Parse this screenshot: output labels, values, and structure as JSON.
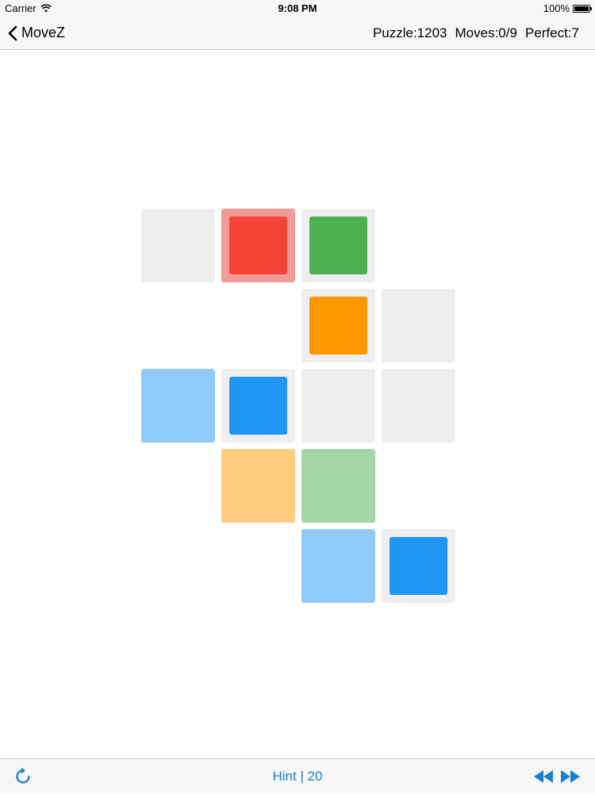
{
  "status": {
    "carrier": "Carrier",
    "time": "9:08 PM",
    "battery": "100%"
  },
  "nav": {
    "back_label": "MoveZ",
    "puzzle": "Puzzle:1203",
    "moves": "Moves:0/9",
    "perfect": "Perfect:7"
  },
  "toolbar": {
    "hint_label": "Hint | 20",
    "restart_icon": "restart-icon",
    "rewind_icon": "rewind-icon",
    "fast_forward_icon": "fast-forward-icon"
  },
  "colors": {
    "accent": "#1a7fd4",
    "empty_cell": "#eeeef0",
    "red": "#f44336",
    "red_bg": "#f19c99",
    "green": "#4caf50",
    "green_target": "#a5d6a7",
    "orange": "#ff9800",
    "orange_target": "#ffcc80",
    "blue": "#2196f3",
    "blue_target": "#90caf9"
  },
  "board": {
    "cells": [
      {
        "row": 0,
        "col": 0,
        "kind": "empty"
      },
      {
        "row": 0,
        "col": 1,
        "kind": "piece",
        "bg": "#f19c99",
        "piece": "#f44336",
        "name": "red"
      },
      {
        "row": 0,
        "col": 2,
        "kind": "piece",
        "bg": "#eeeef0",
        "piece": "#4caf50",
        "name": "green"
      },
      {
        "row": 1,
        "col": 2,
        "kind": "piece",
        "bg": "#eeeef0",
        "piece": "#ff9800",
        "name": "orange"
      },
      {
        "row": 1,
        "col": 3,
        "kind": "empty"
      },
      {
        "row": 2,
        "col": 0,
        "kind": "target",
        "bg": "#90caf9",
        "name": "blue"
      },
      {
        "row": 2,
        "col": 1,
        "kind": "piece",
        "bg": "#eeeef0",
        "piece": "#2196f3",
        "name": "blue"
      },
      {
        "row": 2,
        "col": 2,
        "kind": "empty"
      },
      {
        "row": 2,
        "col": 3,
        "kind": "empty"
      },
      {
        "row": 3,
        "col": 1,
        "kind": "target",
        "bg": "#ffcc80",
        "name": "orange"
      },
      {
        "row": 3,
        "col": 2,
        "kind": "target",
        "bg": "#a5d6a7",
        "name": "green"
      },
      {
        "row": 4,
        "col": 2,
        "kind": "target",
        "bg": "#90caf9",
        "name": "blue"
      },
      {
        "row": 4,
        "col": 3,
        "kind": "piece",
        "bg": "#eeeef0",
        "piece": "#2196f3",
        "name": "blue"
      }
    ]
  }
}
